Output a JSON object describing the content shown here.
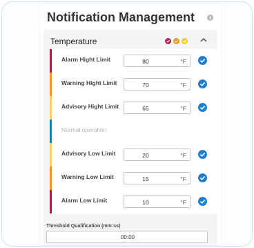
{
  "header": {
    "title": "Notification Management"
  },
  "section": {
    "title": "Temperature",
    "status_colors": [
      "#b0234f",
      "#f09a1a",
      "#f6cd2b"
    ]
  },
  "rows": [
    {
      "label": "Alarm Hight Limit",
      "value": "80",
      "unit": "°F",
      "color": "#9b2150",
      "editable": true
    },
    {
      "label": "Warning Hight Limit",
      "value": "70",
      "unit": "°F",
      "color": "#f09a1a",
      "editable": true
    },
    {
      "label": "Advisory Hight Limit",
      "value": "65",
      "unit": "°F",
      "color": "#f8d45c",
      "editable": true
    },
    {
      "label": "Normal operation",
      "value": "",
      "unit": "",
      "color": "#1682a6",
      "editable": false
    },
    {
      "label": "Advisory Low Limit",
      "value": "20",
      "unit": "°F",
      "color": "#f8d45c",
      "editable": true
    },
    {
      "label": "Warning Low Limit",
      "value": "15",
      "unit": "°F",
      "color": "#f09a1a",
      "editable": true
    },
    {
      "label": "Alarm Low Limit",
      "value": "10",
      "unit": "°F",
      "color": "#9b2150",
      "editable": true
    }
  ],
  "threshold": {
    "label": "Threshold Qualification (mm:ss)",
    "value": "00:00"
  },
  "colors": {
    "check": "#1e7fd0",
    "frame": "#cfe2f3"
  }
}
